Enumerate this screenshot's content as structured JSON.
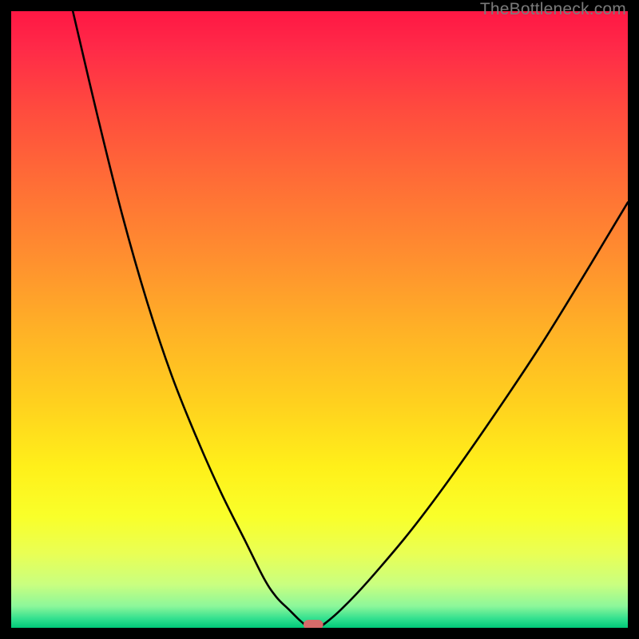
{
  "watermark": "TheBottleneck.com",
  "chart_data": {
    "type": "line",
    "title": "",
    "xlabel": "",
    "ylabel": "",
    "xlim": [
      0,
      100
    ],
    "ylim": [
      0,
      100
    ],
    "curves": [
      {
        "name": "left-curve",
        "x": [
          10,
          14,
          18,
          22,
          26,
          30,
          34,
          38,
          41,
          43,
          45,
          46.5,
          47.5,
          48
        ],
        "y": [
          100,
          83,
          67,
          53,
          41,
          31,
          22,
          14,
          8,
          5,
          3,
          1.5,
          0.6,
          0.1
        ]
      },
      {
        "name": "right-curve",
        "x": [
          50,
          51,
          53,
          56,
          60,
          65,
          71,
          78,
          86,
          94,
          100
        ],
        "y": [
          0.1,
          0.8,
          2.5,
          5.5,
          10,
          16,
          24,
          34,
          46,
          59,
          69
        ]
      }
    ],
    "marker": {
      "x": 49,
      "y": 0.5,
      "w": 3.2,
      "h": 1.6,
      "color": "#d66b6a"
    },
    "gradient_stops": [
      {
        "offset": 0.0,
        "color": "#ff1744"
      },
      {
        "offset": 0.06,
        "color": "#ff2a48"
      },
      {
        "offset": 0.16,
        "color": "#ff4b3e"
      },
      {
        "offset": 0.28,
        "color": "#ff6e36"
      },
      {
        "offset": 0.4,
        "color": "#ff8f2f"
      },
      {
        "offset": 0.52,
        "color": "#ffb226"
      },
      {
        "offset": 0.64,
        "color": "#ffd21e"
      },
      {
        "offset": 0.74,
        "color": "#fff01a"
      },
      {
        "offset": 0.82,
        "color": "#f9ff2a"
      },
      {
        "offset": 0.88,
        "color": "#e9ff55"
      },
      {
        "offset": 0.93,
        "color": "#c9ff80"
      },
      {
        "offset": 0.965,
        "color": "#8cf79a"
      },
      {
        "offset": 0.985,
        "color": "#33e08f"
      },
      {
        "offset": 1.0,
        "color": "#00c878"
      }
    ],
    "curve_color": "#000000",
    "curve_width": 2.6
  }
}
